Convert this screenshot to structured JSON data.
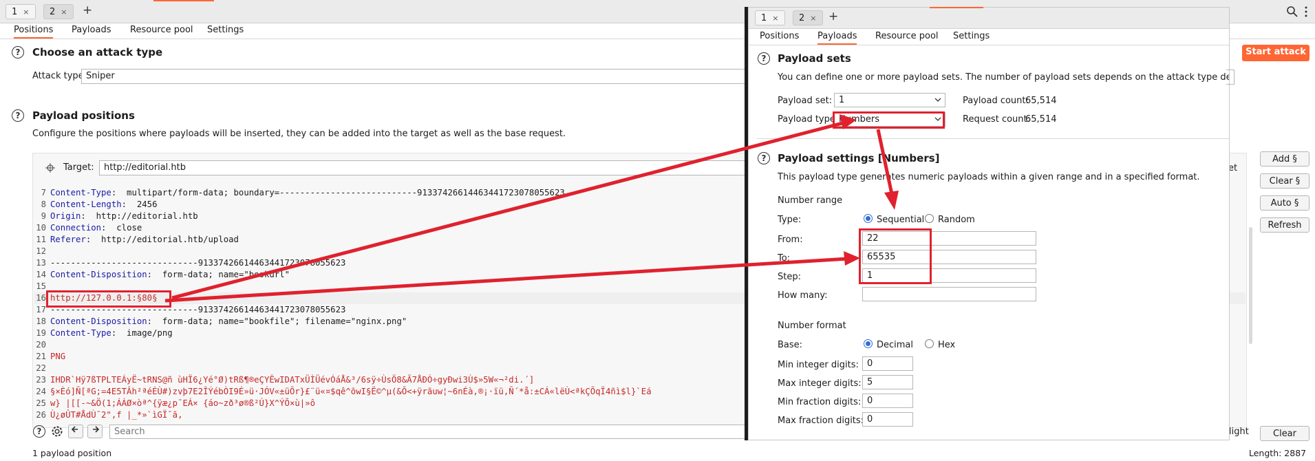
{
  "main": {
    "tabs": [
      {
        "label": "1",
        "close": "×"
      },
      {
        "label": "2",
        "close": "×"
      }
    ],
    "add_tab": "+",
    "subtabs": [
      "Positions",
      "Payloads",
      "Resource pool",
      "Settings"
    ],
    "attack": {
      "title": "Choose an attack type",
      "label": "Attack type:",
      "value": "Sniper",
      "start_button": "Start attack"
    },
    "positions": {
      "title": "Payload positions",
      "desc": "Configure the positions where payloads will be inserted, they can be added into the target as well as the base request.",
      "target_label": "Target:",
      "target_value": "http://editorial.htb",
      "target_cut": "et"
    },
    "side_buttons": [
      "Add §",
      "Clear §",
      "Auto §",
      "Refresh"
    ],
    "lines": [
      {
        "n": "7",
        "key": "Content-Type",
        "val": " multipart/form-data; boundary=---------------------------91337426614463441723078055623"
      },
      {
        "n": "8",
        "key": "Content-Length",
        "val": " 2456"
      },
      {
        "n": "9",
        "key": "Origin",
        "val": " http://editorial.htb"
      },
      {
        "n": "10",
        "key": "Connection",
        "val": " close"
      },
      {
        "n": "11",
        "key": "Referer",
        "val": " http://editorial.htb/upload"
      },
      {
        "n": "12",
        "key": "",
        "val": ""
      },
      {
        "n": "13",
        "key": "",
        "val": "-----------------------------91337426614463441723078055623"
      },
      {
        "n": "14",
        "key": "Content-Disposition",
        "val": " form-data; name=\"bookurl\""
      },
      {
        "n": "15",
        "key": "",
        "val": ""
      },
      {
        "n": "16",
        "key": "",
        "val": "http://127.0.0.1:§80§"
      },
      {
        "n": "17",
        "key": "",
        "val": "-----------------------------91337426614463441723078055623"
      },
      {
        "n": "18",
        "key": "Content-Disposition",
        "val": " form-data; name=\"bookfile\"; filename=\"nginx.png\""
      },
      {
        "n": "19",
        "key": "Content-Type",
        "val": " image/png"
      },
      {
        "n": "20",
        "key": "",
        "val": ""
      },
      {
        "n": "21",
        "key": "",
        "val": "PNG"
      },
      {
        "n": "22",
        "key": "",
        "val": ""
      },
      {
        "n": "23",
        "key": "",
        "val": "IHDR`Hÿ7ßTPLTEÁyË~tRNS@ñ ùHÏ6¿Yé°Ø)tRß¶®eÇYÊwIDATxÜÌÜévÓáÅ&³/6sÿ÷ÙsÖ8&Ã7ÅÐÓ÷gyÐwi3Ù$»5W«¬²di.´]"
      },
      {
        "n": "24",
        "key": "",
        "val": "§×Èó]Ñ[ªG;=4E5TÂh²ªéÉÙ#)zvþ7E2ÎÝébÒI9É»ü·JÓV«±üÕr}£¨ü«¤$qê^õwI§Ë©^µ(&Õ<+ÿrãuw¦~6nÉà,®¡·ïü,Ñ´*å:±CÁ«lëÙ<ªkÇÕqÏ4ñì$l}`Eá"
      },
      {
        "n": "25",
        "key": "",
        "val": "w} |[[-~&Ö(1;ÁÁØ×òª^{ÿæ¿p¯EÁ× {áo~zð³ø®ß²Ú}X^ÝÕ×ù|»ô"
      },
      {
        "n": "26",
        "key": "",
        "val": "Ù¿øÛT#ÅdÙ¯2\",f |_*»`ìGÏ¯ã,"
      }
    ],
    "search_placeholder": "Search",
    "right_cut": "light",
    "clear_button": "Clear",
    "status_left": "1 payload position",
    "status_right": "Length: 2887"
  },
  "popup": {
    "tabs": [
      {
        "label": "1",
        "close": "×"
      },
      {
        "label": "2",
        "close": "×"
      }
    ],
    "add_tab": "+",
    "subtabs": [
      "Positions",
      "Payloads",
      "Resource pool",
      "Settings"
    ],
    "sets": {
      "title": "Payload sets",
      "desc": "You can define one or more payload sets. The number of payload sets depends on the attack type defined in the Pos",
      "set_label": "Payload set:",
      "set_value": "1",
      "count_label": "Payload count:",
      "count_value": "65,514",
      "type_label": "Payload type:",
      "type_value": "Numbers",
      "req_label": "Request count:",
      "req_value": "65,514"
    },
    "settings": {
      "title": "Payload settings [Numbers]",
      "desc": "This payload type generates numeric payloads within a given range and in a specified format.",
      "range_title": "Number range",
      "type_label": "Type:",
      "opt_seq": "Sequential",
      "opt_rand": "Random",
      "from_label": "From:",
      "from_value": "22",
      "to_label": "To:",
      "to_value": "65535",
      "step_label": "Step:",
      "step_value": "1",
      "howmany_label": "How many:",
      "howmany_value": "",
      "format_title": "Number format",
      "base_label": "Base:",
      "opt_dec": "Decimal",
      "opt_hex": "Hex",
      "min_int_label": "Min integer digits:",
      "min_int_value": "0",
      "max_int_label": "Max integer digits:",
      "max_int_value": "5",
      "min_frac_label": "Min fraction digits:",
      "min_frac_value": "0",
      "max_frac_label": "Max fraction digits:",
      "max_frac_value": "0"
    }
  },
  "colors": {
    "accent": "#ff6633",
    "annotation": "#e0212e",
    "radio": "#2f6fd3"
  }
}
